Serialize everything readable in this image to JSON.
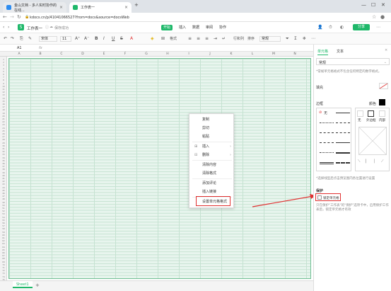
{
  "browser": {
    "tabs": [
      {
        "label": "金山文档 - 多人实时协作的在线...",
        "active": false,
        "color": "#2d8cf0"
      },
      {
        "label": "工作表一",
        "active": true,
        "color": "#1fb86a"
      }
    ],
    "new_tab": "+",
    "url": "kdocs.cn/p/41041066527?from=docs&source=docsWeb",
    "min": "—",
    "max": "☐",
    "close": "✕"
  },
  "doc": {
    "title": "工作表一",
    "save_status": "保存成功",
    "menus": [
      "开始",
      "插入",
      "数据",
      "审阅",
      "协作"
    ],
    "active_menu": "开始",
    "share": "分享"
  },
  "toolbar": {
    "font": "宋体",
    "size": "11",
    "buttons": [
      "↶",
      "↷",
      "⎘",
      "✎",
      "A⁺",
      "A⁻",
      "B",
      "I",
      "U",
      "S",
      "A",
      "◈",
      "⊞",
      "≡",
      "≡",
      "≡",
      "⇥",
      "↵",
      "合并居中",
      "≡"
    ],
    "format": "格式",
    "rowcol": "行和列",
    "sort": "排序",
    "filter": "筛选",
    "style": "常规"
  },
  "formula": {
    "cell": "A1",
    "fx": "fx"
  },
  "grid": {
    "columns": [
      "A",
      "B",
      "C",
      "D",
      "E",
      "F",
      "G",
      "H",
      "I",
      "J",
      "K",
      "L",
      "M",
      "N",
      "O"
    ],
    "rows": [
      "1",
      "2",
      "3",
      "4",
      "5",
      "6",
      "7",
      "8",
      "9",
      "10",
      "11",
      "12",
      "13",
      "14",
      "15",
      "16",
      "17",
      "18",
      "19",
      "20",
      "21",
      "22",
      "23",
      "24",
      "25",
      "26",
      "27",
      "28",
      "29",
      "30",
      "31",
      "32",
      "33",
      "34",
      "35",
      "36",
      "37",
      "38",
      "39",
      "40",
      "41",
      "42",
      "43",
      "44",
      "45",
      "46",
      "47",
      "48",
      "49",
      "50",
      "51",
      "52",
      "53",
      "54",
      "55",
      "56",
      "57",
      "58",
      "59",
      "60",
      "61",
      "62",
      "63",
      "64",
      "65",
      "66",
      "67",
      "68",
      "69",
      "70",
      "71",
      "72",
      "73",
      "74",
      "75"
    ]
  },
  "context_menu": [
    {
      "label": "复制",
      "icon": "⎘",
      "sub": false
    },
    {
      "label": "剪切",
      "icon": "✂",
      "sub": false
    },
    {
      "label": "粘贴",
      "icon": "📋",
      "sub": false
    },
    {
      "label": "插入",
      "icon": "⊞",
      "sub": true
    },
    {
      "label": "删除",
      "icon": "⊟",
      "sub": true
    },
    {
      "label": "清除内容",
      "icon": "",
      "sub": false
    },
    {
      "label": "清除格式",
      "icon": "",
      "sub": false
    },
    {
      "label": "添加评论",
      "icon": "",
      "sub": false
    },
    {
      "label": "插入链接",
      "icon": "",
      "sub": false
    },
    {
      "label": "设置单元格格式",
      "icon": "",
      "sub": false
    }
  ],
  "sheets": {
    "active": "Sheet1",
    "add": "+"
  },
  "panel": {
    "tabs": [
      "单元格",
      "文本"
    ],
    "number_label": "常规",
    "number_hint": "*常规单元格格式不包含任何特定的数字格式。",
    "fill": "填充",
    "border": "边框",
    "color": "颜色",
    "none": "无",
    "outer": "外边框",
    "inner": "内部",
    "border_hint": "*选择线型后点击预览图内各位置进行设置",
    "protect": "保护",
    "lock": "锁定单元格",
    "lock_hint": "只在保护\"工作表\"的\"保护\"选项卡中，启用保护工作表后，锁定单元格才有效",
    "accent": "#1fb86a",
    "highlight": "#e03030"
  }
}
